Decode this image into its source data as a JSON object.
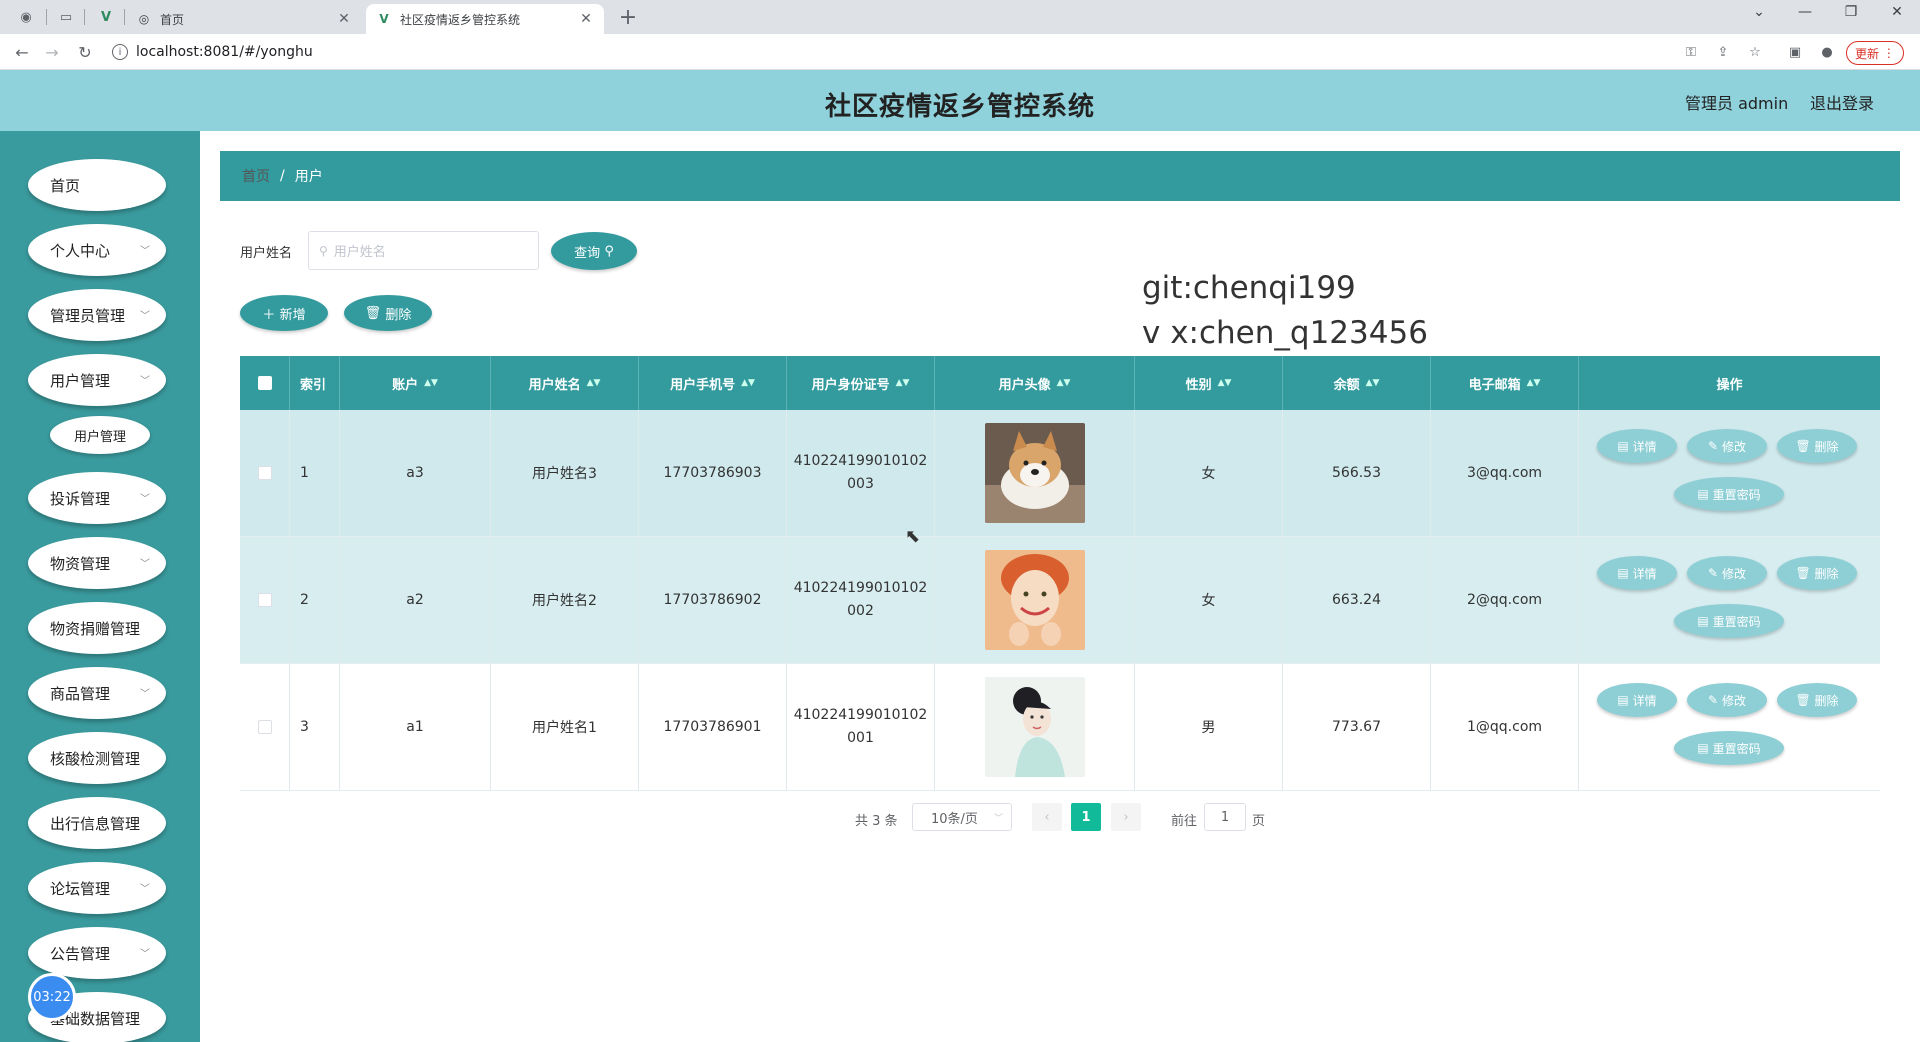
{
  "browser": {
    "tabs": [
      {
        "title": "首页"
      },
      {
        "title": "社区疫情返乡管控系统"
      }
    ],
    "url": "localhost:8081/#/yonghu",
    "update_label": "更新"
  },
  "header": {
    "title": "社区疫情返乡管控系统",
    "user": "管理员 admin",
    "logout": "退出登录",
    "bg_color": "#8fd2db"
  },
  "sidebar": {
    "bg_color": "#3a9b9e",
    "items": [
      {
        "label": "首页"
      },
      {
        "label": "个人中心"
      },
      {
        "label": "管理员管理"
      },
      {
        "label": "用户管理"
      },
      {
        "label": "用户管理"
      },
      {
        "label": "投诉管理"
      },
      {
        "label": "物资管理"
      },
      {
        "label": "物资捐赠管理"
      },
      {
        "label": "商品管理"
      },
      {
        "label": "核酸检测管理"
      },
      {
        "label": "出行信息管理"
      },
      {
        "label": "论坛管理"
      },
      {
        "label": "公告管理"
      },
      {
        "label": "基础数据管理"
      }
    ],
    "timer": "03:22"
  },
  "breadcrumb": {
    "home": "首页",
    "sep": "/",
    "current": "用户"
  },
  "search": {
    "label": "用户姓名",
    "placeholder": "用户姓名",
    "query_button": "查询"
  },
  "actions": {
    "add": "新增",
    "delete": "删除"
  },
  "watermark": {
    "line1": "git:chenqi199",
    "line2": "v x:chen_q123456"
  },
  "table": {
    "columns": [
      "索引",
      "账户",
      "用户姓名",
      "用户手机号",
      "用户身份证号",
      "用户头像",
      "性别",
      "余额",
      "电子邮箱",
      "操作"
    ],
    "rows": [
      {
        "index": "1",
        "account": "a3",
        "name": "用户姓名3",
        "phone": "17703786903",
        "id_line1": "410224199010102",
        "id_line2": "003",
        "gender": "女",
        "balance": "566.53",
        "email": "3@qq.com",
        "avatar": "dog-photo"
      },
      {
        "index": "2",
        "account": "a2",
        "name": "用户姓名2",
        "phone": "17703786902",
        "id_line1": "410224199010102",
        "id_line2": "002",
        "gender": "女",
        "balance": "663.24",
        "email": "2@qq.com",
        "avatar": "woman-photo"
      },
      {
        "index": "3",
        "account": "a1",
        "name": "用户姓名1",
        "phone": "17703786901",
        "id_line1": "410224199010102",
        "id_line2": "001",
        "gender": "男",
        "balance": "773.67",
        "email": "1@qq.com",
        "avatar": "woman-photo"
      }
    ],
    "ops": {
      "detail": "详情",
      "edit": "修改",
      "delete": "删除",
      "reset": "重置密码"
    }
  },
  "pagination": {
    "total": "共 3 条",
    "page_size": "10条/页",
    "current": "1",
    "goto": "前往",
    "goto_value": "1",
    "page_suffix": "页"
  }
}
